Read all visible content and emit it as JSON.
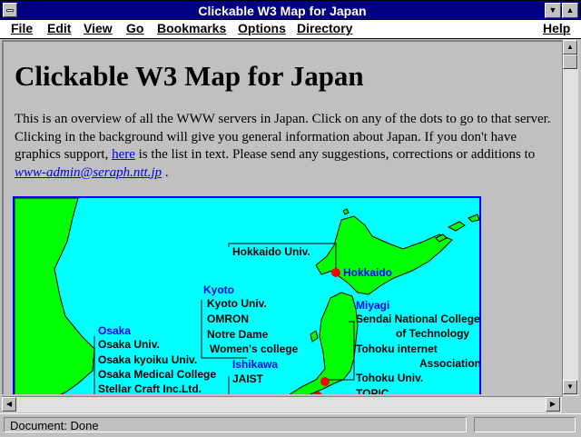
{
  "window": {
    "title": "Clickable W3 Map for Japan"
  },
  "menu": [
    "File",
    "Edit",
    "View",
    "Go",
    "Bookmarks",
    "Options",
    "Directory",
    "Help"
  ],
  "page": {
    "heading": "Clickable W3 Map for Japan",
    "para_1": "This is an overview of all the WWW servers in Japan. Click on any of the dots to go to that server. Clicking in the background will give you general information about Japan. If you don't have graphics support, ",
    "link_here": "here",
    "para_2": " is the list in text. Please send any suggestions, corrections or additions to ",
    "email": "www-admin@seraph.ntt.jp",
    "para_3": " ."
  },
  "map": {
    "hokkaido_univ": "Hokkaido Univ.",
    "hokkaido": "Hokkaido",
    "kyoto": "Kyoto",
    "kyoto_items": [
      "Kyoto Univ.",
      "OMRON",
      "Notre Dame",
      "Women's college"
    ],
    "osaka": "Osaka",
    "osaka_items": [
      "Osaka Univ.",
      "Osaka kyoiku Univ.",
      "Osaka Medical College",
      "Stellar Craft Inc.Ltd."
    ],
    "miyagi": "Miyagi",
    "miyagi_items": [
      "Sendai National College",
      "of Technology",
      "Tohoku internet",
      "Association",
      "Tohoku Univ.",
      "TOPIC"
    ],
    "ishikawa": "Ishikawa",
    "ishikawa_items": [
      "JAIST"
    ],
    "colors": {
      "sea": "#00ffff",
      "land": "#00ff00",
      "dot": "#ff0000",
      "city": "#0000ff"
    }
  },
  "status": {
    "text": "Document: Done"
  }
}
